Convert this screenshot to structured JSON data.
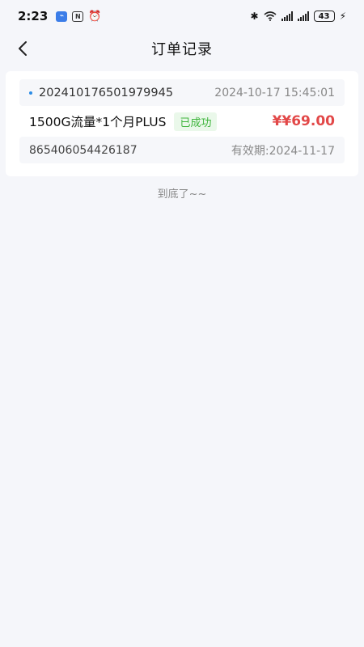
{
  "status_bar": {
    "time": "2:23",
    "battery": "43",
    "icons": [
      "app-chip-icon",
      "nfc-icon",
      "alarm-icon",
      "bluetooth-icon",
      "wifi-icon",
      "signal-icon",
      "signal-icon",
      "battery-icon",
      "charging-icon"
    ]
  },
  "nav": {
    "title": "订单记录",
    "back_icon": "back-arrow-icon"
  },
  "order": {
    "order_no": "20241017650197 9945",
    "order_no_full": "202410176501979945",
    "created_at": "2024-10-17 15:45:01",
    "product_name": "1500G流量*1个月PLUS",
    "status": "已成功",
    "price": "¥¥69.00",
    "device_id": "865406054426187",
    "expire": "有效期:2024-11-17"
  },
  "end_hint": "到底了~~",
  "colors": {
    "background": "#f5f6fa",
    "price": "#e24848",
    "success": "#3db43b",
    "accent": "#2b8ce6"
  }
}
